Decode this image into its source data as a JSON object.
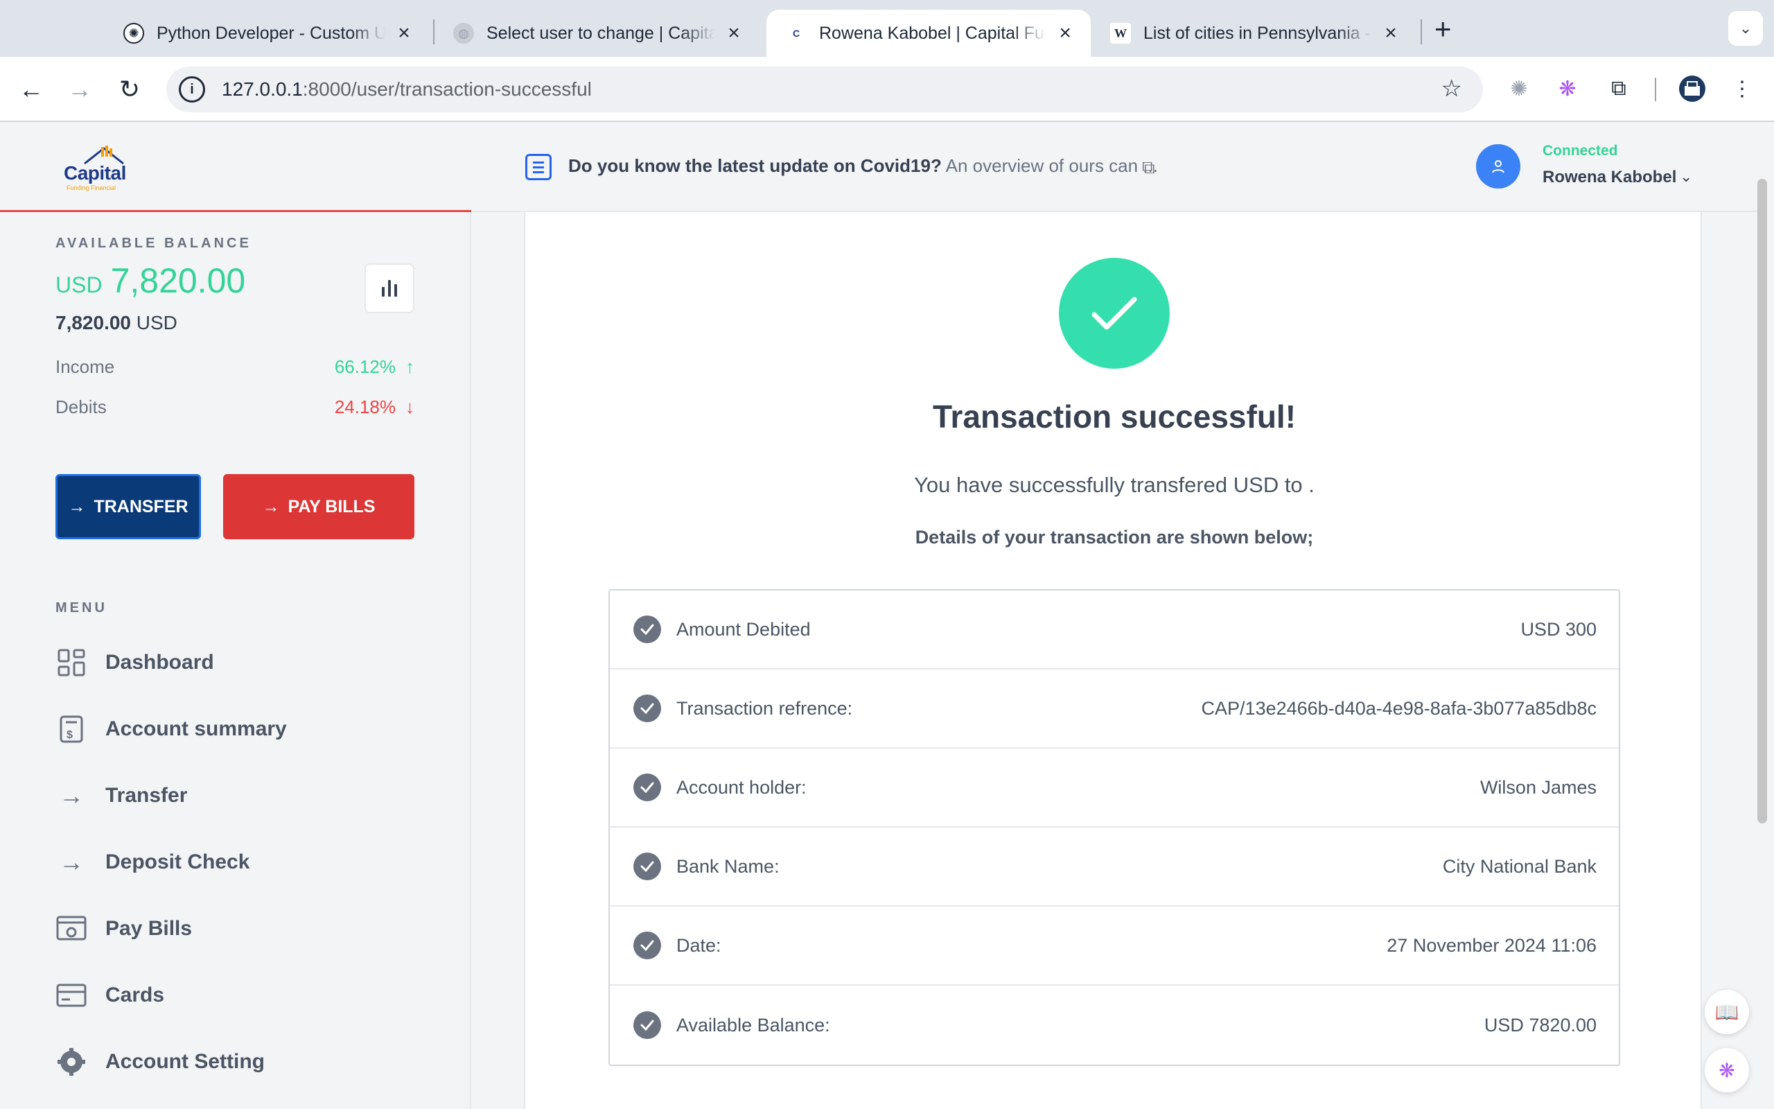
{
  "browser": {
    "tabs": [
      {
        "title": "Python Developer - Custom U",
        "active": false
      },
      {
        "title": "Select user to change | Capita",
        "active": false
      },
      {
        "title": "Rowena Kabobel | Capital Fun",
        "active": true
      },
      {
        "title": "List of cities in Pennsylvania -",
        "active": false
      }
    ],
    "url_host": "127.0.0.1",
    "url_rest": ":8000/user/transaction-successful"
  },
  "sidebar": {
    "logo_text": "Capital",
    "logo_sub": "Funding Financial",
    "balance_label": "AVAILABLE BALANCE",
    "balance_currency": "USD",
    "balance_value": "7,820.00",
    "balance_sub_value": "7,820.00",
    "balance_sub_currency": "USD",
    "income_label": "Income",
    "income_value": "66.12%",
    "debits_label": "Debits",
    "debits_value": "24.18%",
    "transfer_button": "TRANSFER",
    "paybills_button": "PAY BILLS",
    "menu_label": "MENU",
    "menu": [
      {
        "label": "Dashboard"
      },
      {
        "label": "Account summary"
      },
      {
        "label": "Transfer"
      },
      {
        "label": "Deposit Check"
      },
      {
        "label": "Pay Bills"
      },
      {
        "label": "Cards"
      },
      {
        "label": "Account Setting"
      }
    ]
  },
  "header": {
    "news_bold": "Do you know the latest update on Covid19?",
    "news_rest": "An overview of ours can ...",
    "status": "Connected",
    "username": "Rowena Kabobel"
  },
  "main": {
    "title": "Transaction successful!",
    "message": "You have successfully transfered USD to .",
    "details_note": "Details of your transaction are shown below;",
    "details": [
      {
        "label": "Amount Debited",
        "value": "USD 300"
      },
      {
        "label": "Transaction refrence:",
        "value": "CAP/13e2466b-d40a-4e98-8afa-3b077a85db8c"
      },
      {
        "label": "Account holder:",
        "value": "Wilson James"
      },
      {
        "label": "Bank Name:",
        "value": "City National Bank"
      },
      {
        "label": "Date:",
        "value": "27 November 2024 11:06"
      },
      {
        "label": "Available Balance:",
        "value": "USD 7820.00"
      }
    ]
  },
  "colors": {
    "accent_green": "#34d399",
    "success_circle": "#34dfad",
    "danger_red": "#dc3636",
    "primary_navy": "#0b3a78"
  }
}
